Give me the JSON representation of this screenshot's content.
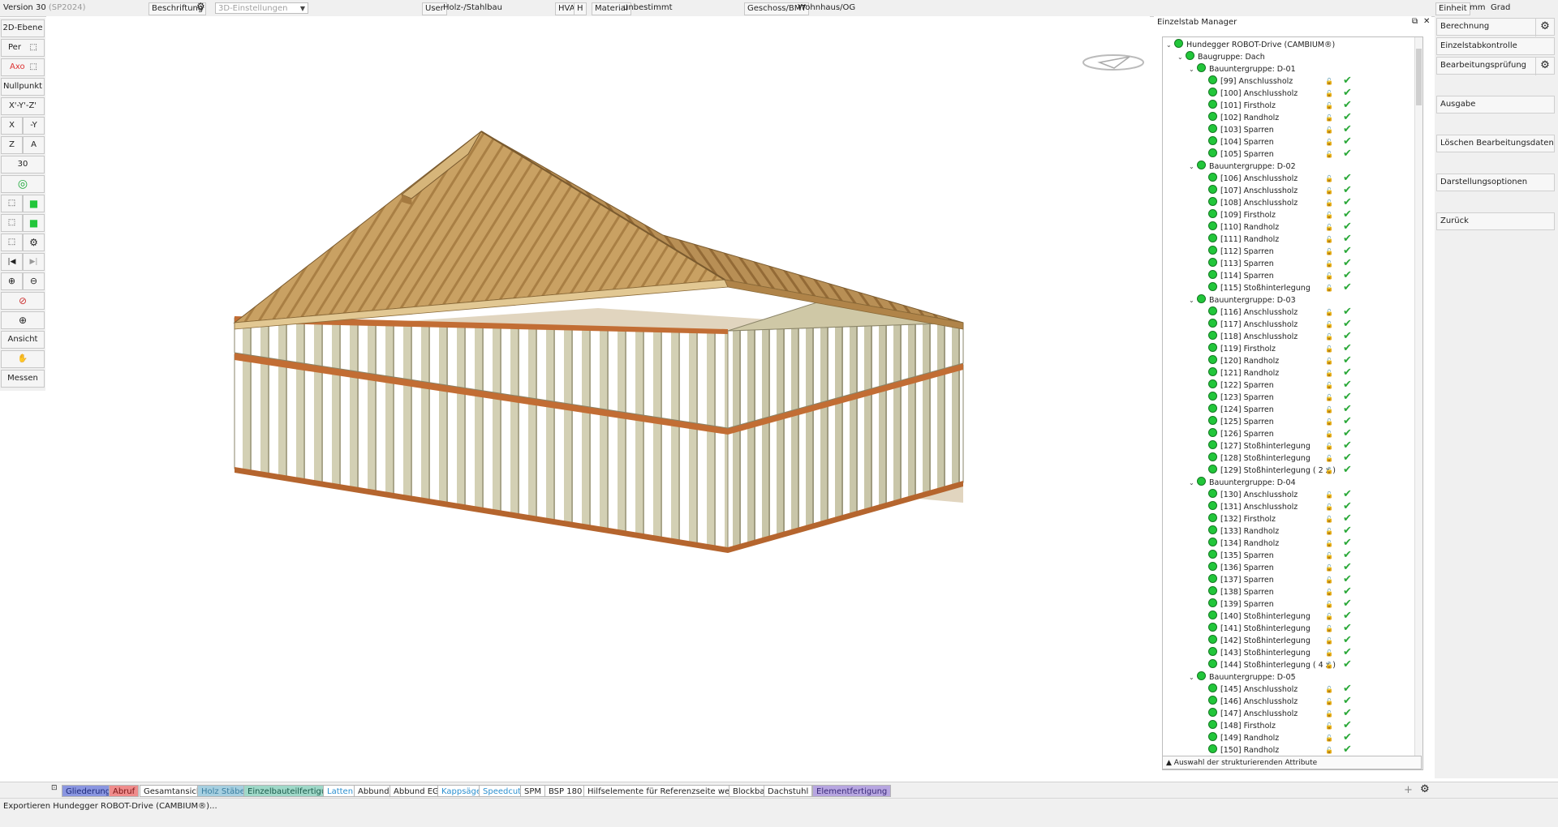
{
  "topbar": {
    "version": "Version 30",
    "sp": "(SP2024)",
    "beschriftung": "Beschriftung",
    "settings3d": "3D-Einstellungen",
    "user_label": "User",
    "user_value": "Holz-/Stahlbau",
    "hva": "HVA",
    "h": "H",
    "material_label": "Material",
    "material_value": "unbestimmt",
    "geschoss_label": "Geschoss/BMT",
    "geschoss_value": "Wohnhaus/OG",
    "einheit": "Einheit",
    "mm": "mm",
    "grad": "Grad"
  },
  "left_toolbar": {
    "ebene": "2D-Ebene",
    "per": "Per",
    "axo": "Axo",
    "nullpunkt": "Nullpunkt",
    "xyz": "X'-Y'-Z'",
    "x": "X",
    "neg_y": "-Y",
    "z": "Z",
    "a": "A",
    "thirty": "30",
    "ansicht": "Ansicht",
    "messen": "Messen"
  },
  "manager": {
    "title": "Einzelstab Manager",
    "root": "Hundegger ROBOT-Drive (CAMBIUM®)",
    "baugruppe": "Baugruppe: Dach",
    "groups": [
      {
        "name": "Bauuntergruppe: D-01",
        "items": [
          "[99] Anschlussholz",
          "[100] Anschlussholz",
          "[101] Firstholz",
          "[102] Randholz",
          "[103] Sparren",
          "[104] Sparren",
          "[105] Sparren"
        ]
      },
      {
        "name": "Bauuntergruppe: D-02",
        "items": [
          "[106] Anschlussholz",
          "[107] Anschlussholz",
          "[108] Anschlussholz",
          "[109] Firstholz",
          "[110] Randholz",
          "[111] Randholz",
          "[112] Sparren",
          "[113] Sparren",
          "[114] Sparren",
          "[115] Stoßhinterlegung"
        ]
      },
      {
        "name": "Bauuntergruppe: D-03",
        "items": [
          "[116] Anschlussholz",
          "[117] Anschlussholz",
          "[118] Anschlussholz",
          "[119] Firstholz",
          "[120] Randholz",
          "[121] Randholz",
          "[122] Sparren",
          "[123] Sparren",
          "[124] Sparren",
          "[125] Sparren",
          "[126] Sparren",
          "[127] Stoßhinterlegung",
          "[128] Stoßhinterlegung",
          "[129] Stoßhinterlegung ( 2 x )"
        ]
      },
      {
        "name": "Bauuntergruppe: D-04",
        "items": [
          "[130] Anschlussholz",
          "[131] Anschlussholz",
          "[132] Firstholz",
          "[133] Randholz",
          "[134] Randholz",
          "[135] Sparren",
          "[136] Sparren",
          "[137] Sparren",
          "[138] Sparren",
          "[139] Sparren",
          "[140] Stoßhinterlegung",
          "[141] Stoßhinterlegung",
          "[142] Stoßhinterlegung",
          "[143] Stoßhinterlegung",
          "[144] Stoßhinterlegung ( 4 x )"
        ]
      },
      {
        "name": "Bauuntergruppe: D-05",
        "items": [
          "[145] Anschlussholz",
          "[146] Anschlussholz",
          "[147] Anschlussholz",
          "[148] Firstholz",
          "[149] Randholz",
          "[150] Randholz"
        ]
      }
    ],
    "footer": "Auswahl der strukturierenden Attribute"
  },
  "right_panel": {
    "berechnung": "Berechnung",
    "einzelstabkontrolle": "Einzelstabkontrolle",
    "bearbeitungspruefung": "Bearbeitungsprüfung",
    "ausgabe": "Ausgabe",
    "loeschen": "Löschen Bearbeitungsdaten",
    "darstellung": "Darstellungsoptionen",
    "zurueck": "Zurück"
  },
  "tabs": [
    {
      "label": "Gliederung",
      "bg": "#8a96e0",
      "fg": "#1d2a7a"
    },
    {
      "label": "Abruf",
      "bg": "#ef8c8c",
      "fg": "#7a1414"
    },
    {
      "label": "Gesamtansicht",
      "bg": "#ffffff",
      "fg": "#222222"
    },
    {
      "label": "Holz Stäbe",
      "bg": "#a6cfe0",
      "fg": "#3a7ea0"
    },
    {
      "label": "Einzelbauteilfertigung",
      "bg": "#9fd8c8",
      "fg": "#1a5a4a"
    },
    {
      "label": "Latten",
      "bg": "#ffffff",
      "fg": "#2a8fd0"
    },
    {
      "label": "Abbund",
      "bg": "#ffffff",
      "fg": "#222222"
    },
    {
      "label": "Abbund EG",
      "bg": "#ffffff",
      "fg": "#222222"
    },
    {
      "label": "Kappsäge",
      "bg": "#ffffff",
      "fg": "#2a8fd0"
    },
    {
      "label": "Speedcut",
      "bg": "#ffffff",
      "fg": "#2a8fd0"
    },
    {
      "label": "SPM",
      "bg": "#ffffff",
      "fg": "#222222"
    },
    {
      "label": "BSP 180",
      "bg": "#ffffff",
      "fg": "#222222"
    },
    {
      "label": "Hilfselemente für Referenzseite wechseln",
      "bg": "#ffffff",
      "fg": "#222222"
    },
    {
      "label": "Blockbau",
      "bg": "#ffffff",
      "fg": "#222222"
    },
    {
      "label": "Dachstuhl",
      "bg": "#ffffff",
      "fg": "#222222"
    },
    {
      "label": "Elementfertigung",
      "bg": "#b7a6e0",
      "fg": "#3a2a7a"
    }
  ],
  "status": "Exportieren Hundegger ROBOT-Drive (CAMBIUM®)..."
}
